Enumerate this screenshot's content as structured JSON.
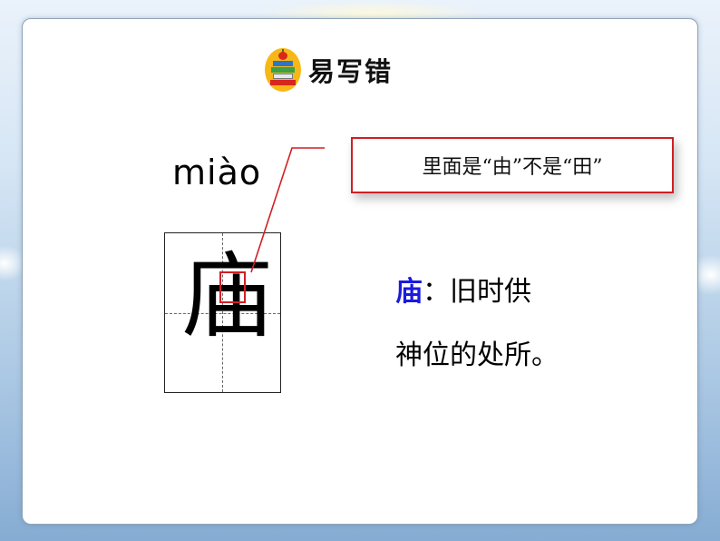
{
  "slide": {
    "title": "易写错",
    "title_icon": "books-with-apple-icon",
    "pinyin": "miào",
    "character": "庙",
    "callout_text": "里面是“由”不是“田”",
    "definition": {
      "keyword": "庙",
      "colon": "：",
      "line1_rest": "旧时供",
      "line2": "神位的处所。"
    }
  },
  "colors": {
    "accent_red": "#d11f23",
    "keyword_blue": "#1a1ae0",
    "icon_gold": "#f7b817"
  }
}
